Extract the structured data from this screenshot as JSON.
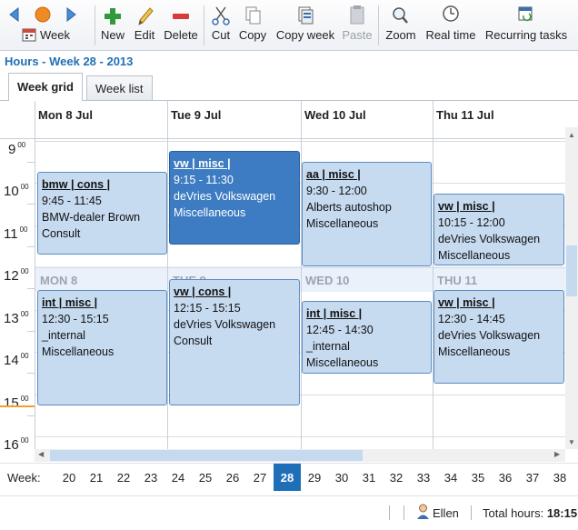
{
  "toolbar": {
    "week_label": "Week",
    "new_label": "New",
    "edit_label": "Edit",
    "delete_label": "Delete",
    "cut_label": "Cut",
    "copy_label": "Copy",
    "copy_week_label": "Copy week",
    "paste_label": "Paste",
    "zoom_label": "Zoom",
    "realtime_label": "Real time",
    "recurring_label": "Recurring tasks"
  },
  "page_title": "Hours - Week 28 - 2013",
  "tabs": {
    "week_grid": "Week grid",
    "week_list": "Week list"
  },
  "days": {
    "mon": "Mon 8 Jul",
    "tue": "Tue 9 Jul",
    "wed": "Wed 10 Jul",
    "thu": "Thu 11 Jul"
  },
  "ghost_days": {
    "mon": "MON 8",
    "tue": "TUE 9",
    "wed": "WED 10",
    "thu": "THU 11"
  },
  "hours": {
    "h9": "9",
    "h10": "10",
    "h11": "11",
    "h12": "12",
    "h13": "13",
    "h14": "14",
    "h15": "15",
    "h16": "16",
    "minutes": "00"
  },
  "appointments": {
    "a1": {
      "title": "bmw | cons |",
      "time": "9:45 - 11:45",
      "client": "BMW-dealer Brown",
      "type": "Consult"
    },
    "a2": {
      "title": "vw | misc |",
      "time": "9:15 - 11:30",
      "client": "deVries Volkswagen",
      "type": "Miscellaneous"
    },
    "a3": {
      "title": "aa | misc |",
      "time": "9:30 - 12:00",
      "client": "Alberts autoshop",
      "type": "Miscellaneous"
    },
    "a4": {
      "title": "vw | misc |",
      "time": "10:15 - 12:00",
      "client": "deVries Volkswagen",
      "type": "Miscellaneous"
    },
    "a5": {
      "title": "int | misc |",
      "time": "12:30 - 15:15",
      "client": "_internal",
      "type": "Miscellaneous"
    },
    "a6": {
      "title": "vw | cons |",
      "time": "12:15 - 15:15",
      "client": "deVries Volkswagen",
      "type": "Consult"
    },
    "a7": {
      "title": "int | misc |",
      "time": "12:45 - 14:30",
      "client": "_internal",
      "type": "Miscellaneous"
    },
    "a8": {
      "title": "vw | misc |",
      "time": "12:30 - 14:45",
      "client": "deVries Volkswagen",
      "type": "Miscellaneous"
    }
  },
  "week_strip": {
    "label": "Week:",
    "weeks": [
      "20",
      "21",
      "22",
      "23",
      "24",
      "25",
      "26",
      "27",
      "28",
      "29",
      "30",
      "31",
      "32",
      "33",
      "34",
      "35",
      "36",
      "37",
      "38"
    ],
    "active": "28"
  },
  "status": {
    "user": "Ellen",
    "total_label": "Total hours:",
    "total_value": "18:15"
  },
  "colors": {
    "accent": "#1f6fb8",
    "appointment": "#c6daf0",
    "selected": "#3d7cc2",
    "delete": "#d83b3b",
    "new": "#2e9a3a"
  }
}
